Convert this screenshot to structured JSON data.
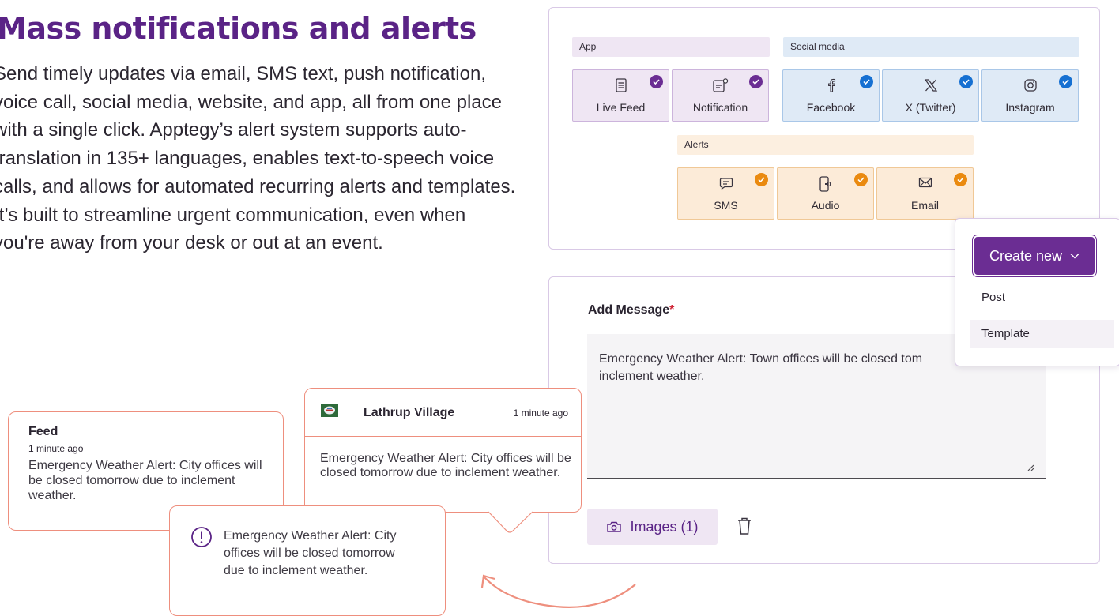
{
  "hero": {
    "title": "Mass notifications and alerts",
    "body": "Send timely updates via email, SMS text, push notification, voice call, social media, website, and app, all from one place with a single click. Apptegy’s alert system supports auto-translation in 135+ languages, enables text-to-speech voice calls, and allows for automated recurring alerts and templates. It’s built to streamline urgent communication, even when you're away from your desk or out at an event."
  },
  "channels": {
    "app_label": "App",
    "social_label": "Social media",
    "alerts_label": "Alerts",
    "app": [
      {
        "label": "Live Feed",
        "icon": "live-feed-icon",
        "checked": true
      },
      {
        "label": "Notification",
        "icon": "notification-icon",
        "checked": true
      }
    ],
    "social": [
      {
        "label": "Facebook",
        "icon": "facebook-icon",
        "checked": true
      },
      {
        "label": "X (Twitter)",
        "icon": "x-twitter-icon",
        "checked": true
      },
      {
        "label": "Instagram",
        "icon": "instagram-icon",
        "checked": true
      }
    ],
    "alerts": [
      {
        "label": "SMS",
        "icon": "sms-icon",
        "checked": true
      },
      {
        "label": "Audio",
        "icon": "audio-icon",
        "checked": true
      },
      {
        "label": "Email",
        "icon": "email-icon",
        "checked": true
      }
    ]
  },
  "message": {
    "label": "Add Message",
    "required_mark": "*",
    "text": "Emergency Weather Alert: Town offices will be closed tom\ninclement weather.",
    "images_label": "Images (1)"
  },
  "create_menu": {
    "button_label": "Create new",
    "items": [
      "Post",
      "Template"
    ]
  },
  "feed_preview": {
    "title": "Feed",
    "time": "1 minute ago",
    "message": "Emergency Weather Alert: City offices will be closed tomorrow due to inclement weather."
  },
  "push_preview": {
    "sender": "Lathrup Village",
    "time": "1 minute ago",
    "message": "Emergency Weather Alert: City offices will be closed tomorrow due to inclement weather."
  },
  "sms_preview": {
    "message": "Emergency Weather Alert: City offices will be closed tomorrow due to inclement weather."
  },
  "colors": {
    "brand_purple": "#5a2386",
    "app_check": "#6b2d93",
    "social_check": "#1670d2",
    "alert_check": "#ea8a10",
    "coral_border": "#ee8f7e"
  }
}
